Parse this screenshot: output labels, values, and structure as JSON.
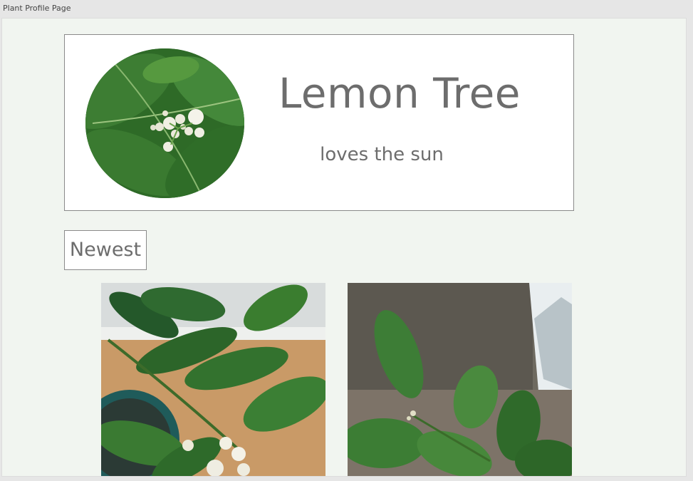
{
  "window": {
    "title": "Plant Profile Page"
  },
  "profile": {
    "avatar_icon": "lemon-blossom-photo",
    "name": "Lemon Tree",
    "tagline": "loves the sun"
  },
  "section": {
    "heading": "Newest"
  },
  "photos": [
    {
      "icon": "lemon-tree-photo"
    },
    {
      "icon": "lemon-tree-photo"
    }
  ],
  "colors": {
    "page_background": "#f1f5f0",
    "card_background": "#ffffff",
    "border": "#8a8a8a",
    "text": "#6d6d6d",
    "leaf": "#2f6b2b"
  }
}
